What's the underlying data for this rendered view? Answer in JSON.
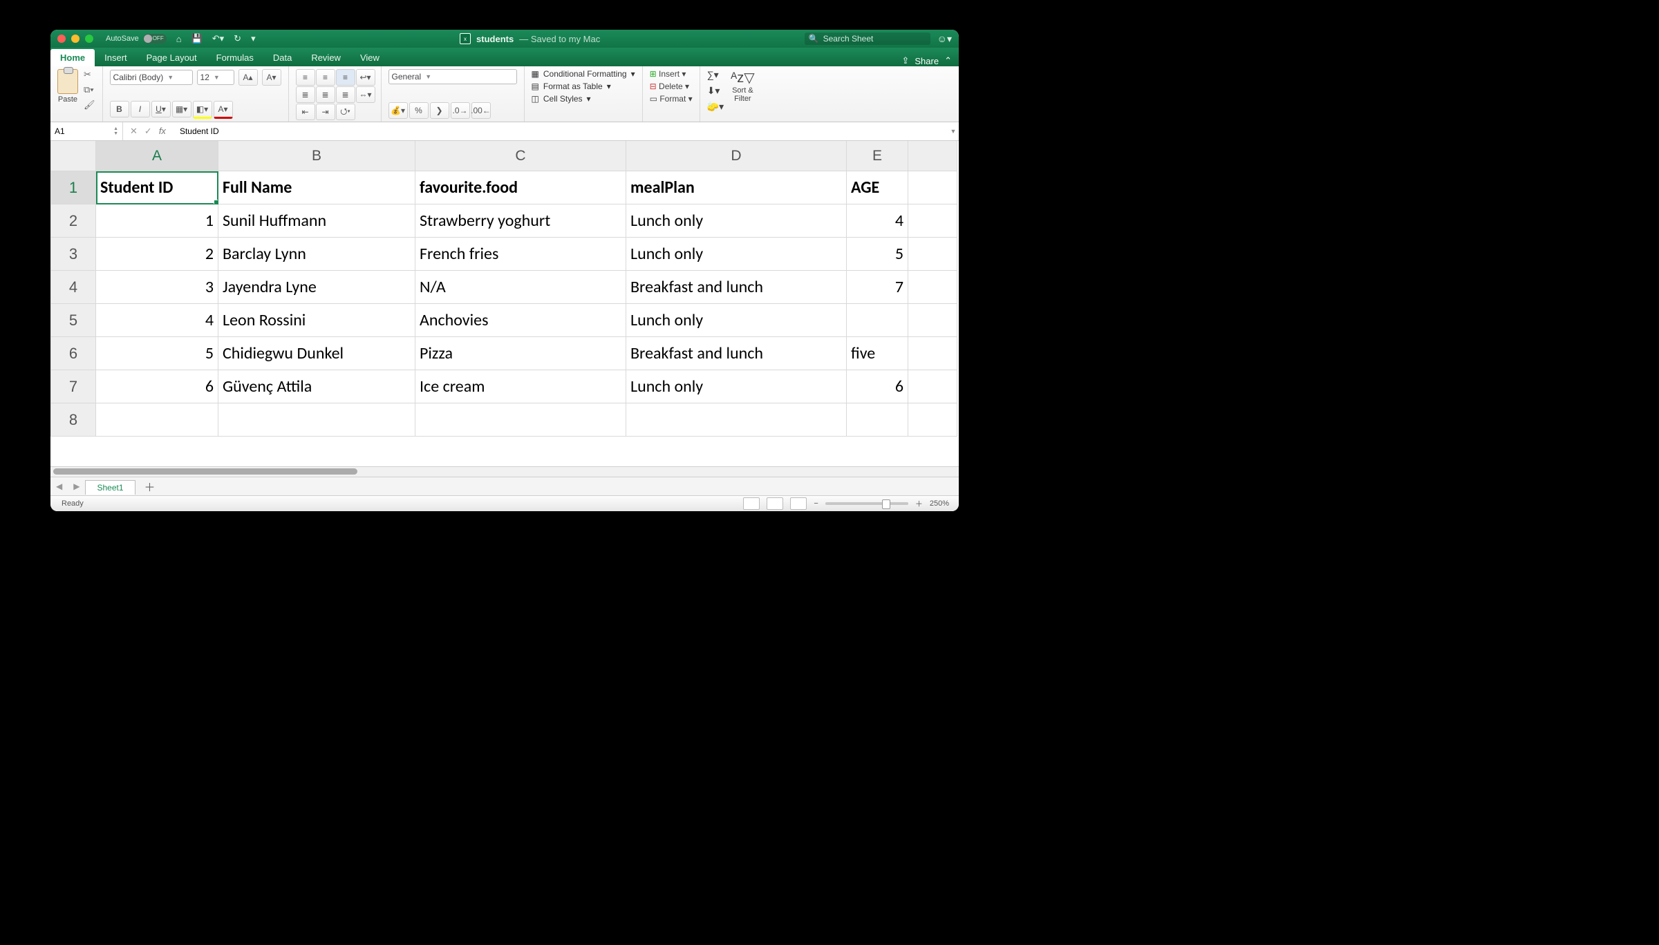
{
  "app": {
    "autosave_label": "AutoSave",
    "autosave_state": "OFF",
    "filename": "students",
    "saved_status": "— Saved to my Mac",
    "search_placeholder": "Search Sheet",
    "share_label": "Share"
  },
  "ribbon_tabs": [
    "Home",
    "Insert",
    "Page Layout",
    "Formulas",
    "Data",
    "Review",
    "View"
  ],
  "active_tab": "Home",
  "font": {
    "name": "Calibri (Body)",
    "size": "12"
  },
  "number_format": "General",
  "clipboard": {
    "paste": "Paste"
  },
  "styles": {
    "cond": "Conditional Formatting",
    "table": "Format as Table",
    "cell": "Cell Styles"
  },
  "cells": {
    "insert": "Insert",
    "delete": "Delete",
    "format": "Format"
  },
  "editing": {
    "sort": "Sort &",
    "filter": "Filter"
  },
  "name_box": "A1",
  "formula_bar": "Student ID",
  "columns": [
    "A",
    "B",
    "C",
    "D",
    "E"
  ],
  "rows": [
    "1",
    "2",
    "3",
    "4",
    "5",
    "6",
    "7",
    "8"
  ],
  "data": {
    "headers": {
      "A": "Student ID",
      "B": "Full Name",
      "C": "favourite.food",
      "D": "mealPlan",
      "E": "AGE"
    },
    "r2": {
      "A": "1",
      "B": "Sunil Huffmann",
      "C": "Strawberry yoghurt",
      "D": "Lunch only",
      "E": "4"
    },
    "r3": {
      "A": "2",
      "B": "Barclay Lynn",
      "C": "French fries",
      "D": "Lunch only",
      "E": "5"
    },
    "r4": {
      "A": "3",
      "B": "Jayendra Lyne",
      "C": "N/A",
      "D": "Breakfast and lunch",
      "E": "7"
    },
    "r5": {
      "A": "4",
      "B": "Leon Rossini",
      "C": "Anchovies",
      "D": "Lunch only",
      "E": ""
    },
    "r6": {
      "A": "5",
      "B": "Chidiegwu Dunkel",
      "C": "Pizza",
      "D": "Breakfast and lunch",
      "E": "five"
    },
    "r7": {
      "A": "6",
      "B": "Güvenç Attila",
      "C": "Ice cream",
      "D": "Lunch only",
      "E": "6"
    }
  },
  "sheet_tab": "Sheet1",
  "status": {
    "ready": "Ready",
    "zoom": "250%"
  },
  "chart_data": {
    "type": "table",
    "title": "students",
    "columns": [
      "Student ID",
      "Full Name",
      "favourite.food",
      "mealPlan",
      "AGE"
    ],
    "rows": [
      [
        1,
        "Sunil Huffmann",
        "Strawberry yoghurt",
        "Lunch only",
        "4"
      ],
      [
        2,
        "Barclay Lynn",
        "French fries",
        "Lunch only",
        "5"
      ],
      [
        3,
        "Jayendra Lyne",
        "N/A",
        "Breakfast and lunch",
        "7"
      ],
      [
        4,
        "Leon Rossini",
        "Anchovies",
        "Lunch only",
        ""
      ],
      [
        5,
        "Chidiegwu Dunkel",
        "Pizza",
        "Breakfast and lunch",
        "five"
      ],
      [
        6,
        "Güvenç Attila",
        "Ice cream",
        "Lunch only",
        "6"
      ]
    ]
  }
}
